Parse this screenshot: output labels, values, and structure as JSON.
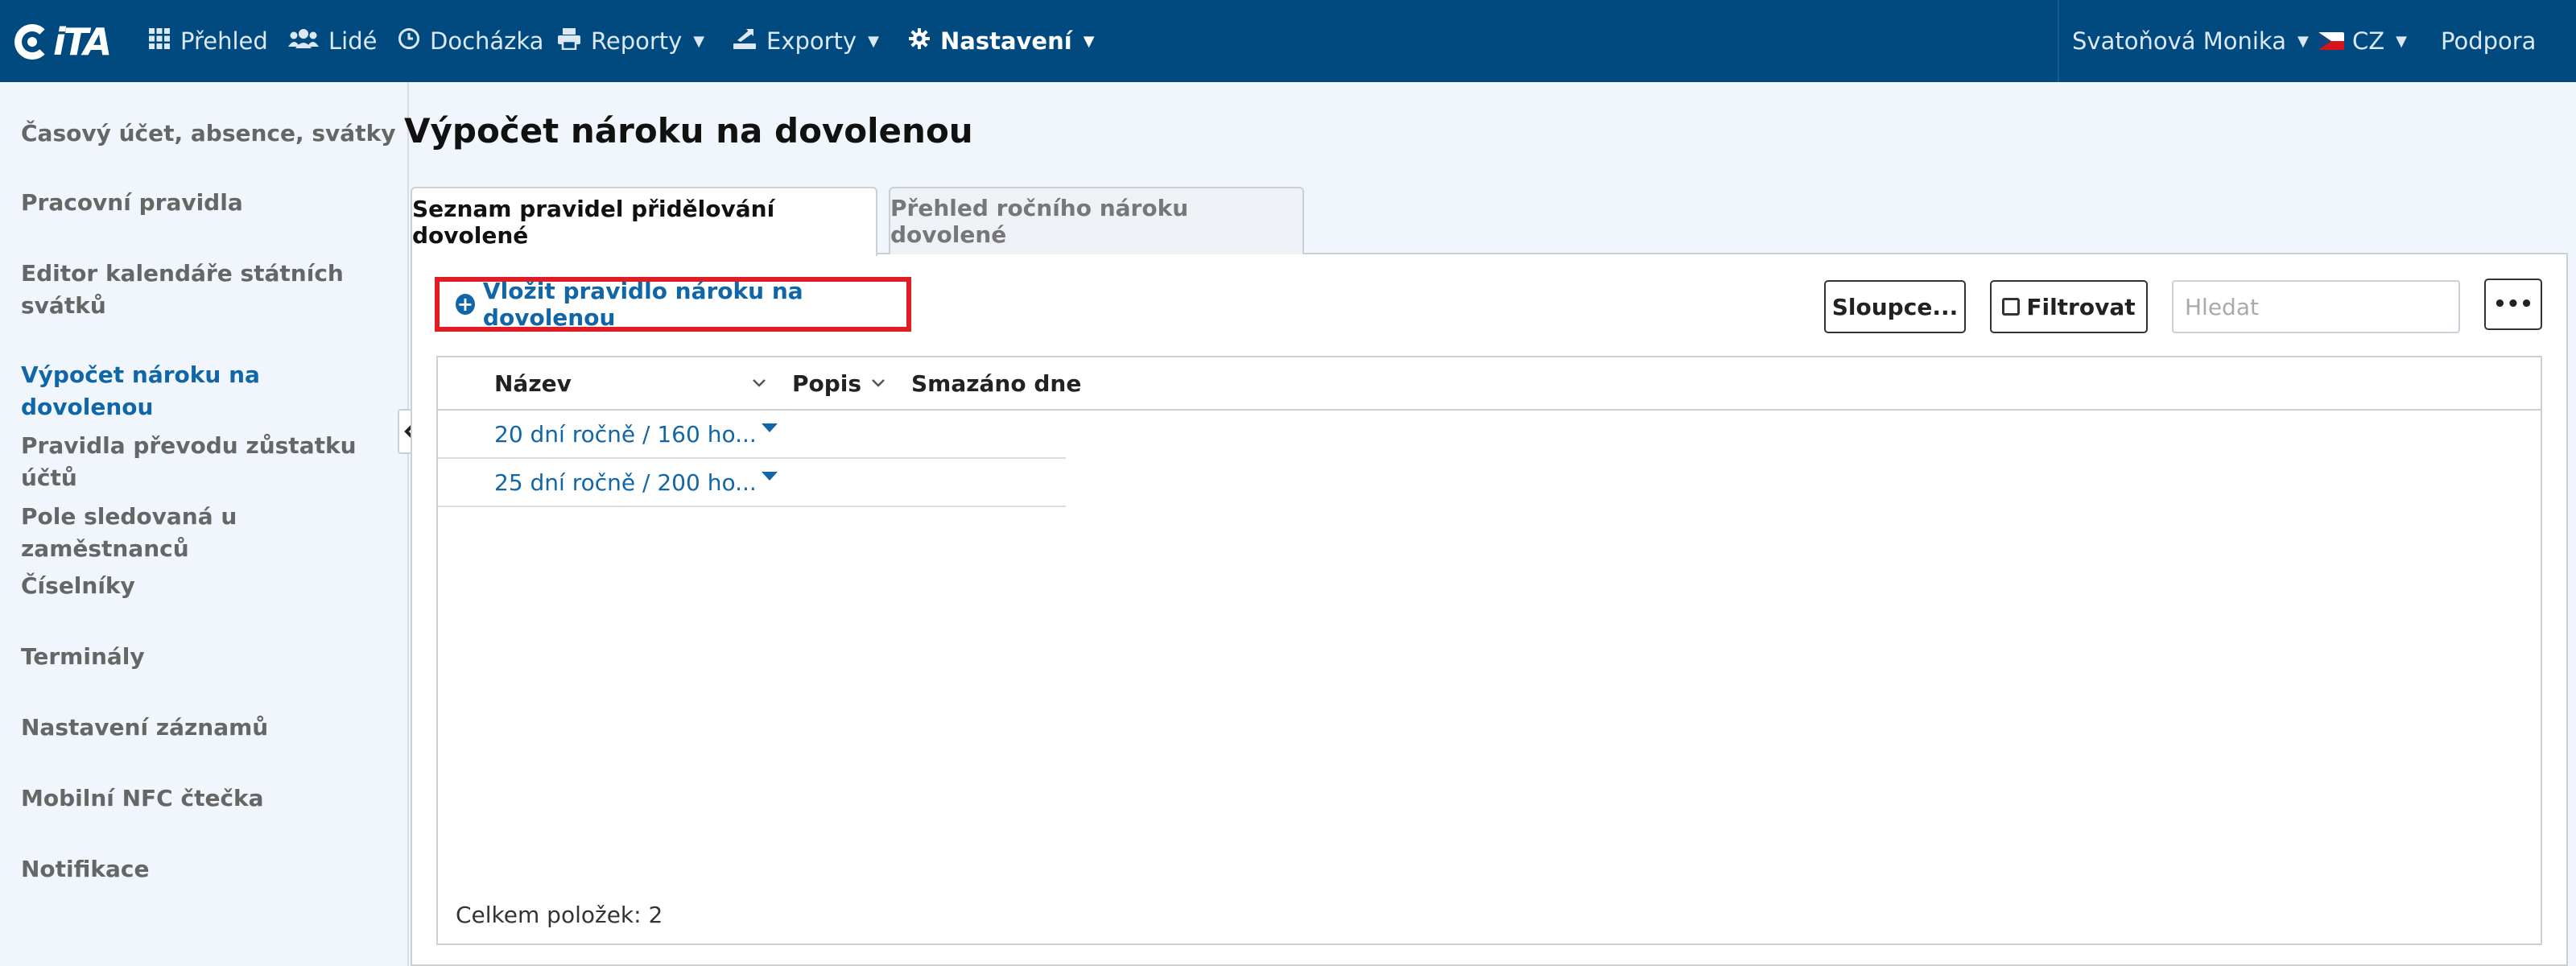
{
  "app": {
    "logo_text": "iTA"
  },
  "nav": {
    "items": [
      {
        "label": "Přehled",
        "icon": "grid-icon"
      },
      {
        "label": "Lidé",
        "icon": "users-icon"
      },
      {
        "label": "Docházka",
        "icon": "clock-icon"
      },
      {
        "label": "Reporty",
        "icon": "printer-icon"
      },
      {
        "label": "Exporty",
        "icon": "export-icon"
      },
      {
        "label": "Nastavení",
        "icon": "gear-icon"
      }
    ],
    "user": "Svatoňová Monika",
    "language": "CZ",
    "support": "Podpora"
  },
  "sidebar": {
    "items": [
      {
        "label": "Časový účet, absence, svátky"
      },
      {
        "label": "Pracovní pravidla"
      },
      {
        "label": "Editor kalendáře státních svátků"
      },
      {
        "label": "Výpočet nároku na dovolenou"
      },
      {
        "label": "Pravidla převodu zůstatku účtů"
      },
      {
        "label": "Pole sledovaná u zaměstnanců"
      },
      {
        "label": "Číselníky"
      },
      {
        "label": "Terminály"
      },
      {
        "label": "Nastavení záznamů"
      },
      {
        "label": "Mobilní NFC čtečka"
      },
      {
        "label": "Notifikace"
      }
    ],
    "active_index": 3
  },
  "page": {
    "title": "Výpočet nároku na dovolenou",
    "tabs": [
      {
        "label": "Seznam pravidel přidělování dovolené"
      },
      {
        "label": "Přehled ročního nároku dovolené"
      }
    ]
  },
  "toolbar": {
    "add_label": "Vložit pravidlo nároku na dovolenou",
    "columns_label": "Sloupce...",
    "filter_label": "Filtrovat",
    "search_placeholder": "Hledat",
    "more_label": "•••"
  },
  "table": {
    "columns": [
      {
        "label": "Název"
      },
      {
        "label": "Popis"
      },
      {
        "label": "Smazáno dne"
      }
    ],
    "rows": [
      {
        "name": "20 dní ročně / 160 ho..."
      },
      {
        "name": "25 dní ročně / 200 ho..."
      }
    ],
    "footer": "Celkem položek: 2"
  },
  "colors": {
    "topbar": "#004a80",
    "accent": "#1166a8",
    "highlight_border": "#e21c24"
  }
}
